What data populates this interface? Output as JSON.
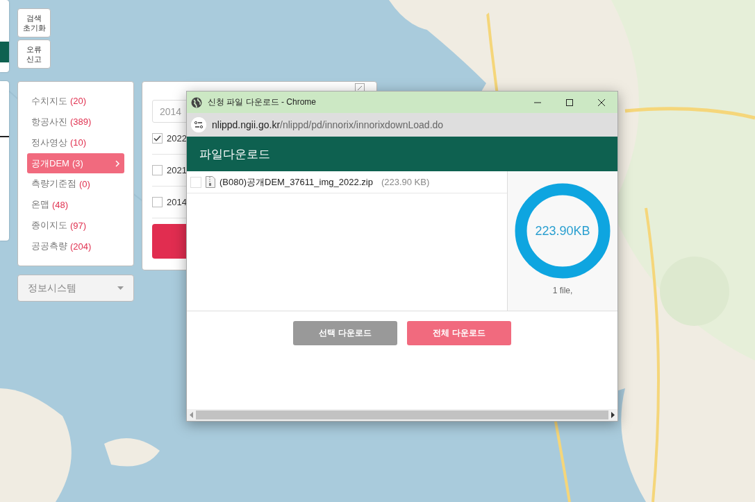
{
  "side_buttons": [
    {
      "label": "검색 초기화"
    },
    {
      "label": "오류 신고"
    }
  ],
  "categories": [
    {
      "label": "수치지도",
      "count": "(20)",
      "selected": false
    },
    {
      "label": "항공사진",
      "count": "(389)",
      "selected": false
    },
    {
      "label": "정사영상",
      "count": "(10)",
      "selected": false
    },
    {
      "label": "공개DEM",
      "count": "(3)",
      "selected": true
    },
    {
      "label": "측량기준점",
      "count": "(0)",
      "selected": false
    },
    {
      "label": "온맵",
      "count": "(48)",
      "selected": false
    },
    {
      "label": "종이지도",
      "count": "(97)",
      "selected": false
    },
    {
      "label": "공공측량",
      "count": "(204)",
      "selected": false
    }
  ],
  "dropdown": {
    "value": "정보시스템"
  },
  "year_panel": {
    "select_value": "2014",
    "years": [
      {
        "label": "2022",
        "checked": true
      },
      {
        "label": "2021",
        "checked": false
      },
      {
        "label": "2014",
        "checked": false
      }
    ]
  },
  "popup": {
    "title": "신청 파일 다운로드 - Chrome",
    "url_host": "nlippd.ngii.go.kr",
    "url_path": "/nlippd/pd/innorix/innorixdownLoad.do",
    "header": "파일다운로드",
    "files": [
      {
        "name": "(B080)공개DEM_37611_img_2022.zip",
        "size": "(223.90 KB)",
        "checked": false
      }
    ],
    "total_size": "223.90KB",
    "file_count": "1 file,",
    "buttons": [
      {
        "label": "선택 다운로드",
        "kind": "secondary"
      },
      {
        "label": "전체 다운로드",
        "kind": "primary"
      }
    ]
  }
}
